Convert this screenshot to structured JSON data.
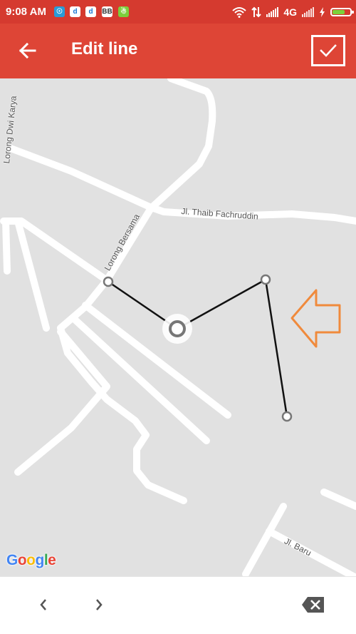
{
  "status_bar": {
    "time": "9:08 AM",
    "network": "4G",
    "notifications": [
      {
        "glyph": "☉",
        "bg": "#2a9bd7",
        "fg": "#ffffff"
      },
      {
        "glyph": "d",
        "bg": "#ffffff",
        "fg": "#1976d2"
      },
      {
        "glyph": "d",
        "bg": "#ffffff",
        "fg": "#1976d2"
      },
      {
        "glyph": "BB",
        "bg": "#ffffff",
        "fg": "#333333"
      },
      {
        "glyph": "☃",
        "bg": "#7ccf3b",
        "fg": "#ffffff"
      }
    ]
  },
  "toolbar": {
    "title": "Edit line",
    "back_icon": "arrow-left-icon",
    "confirm_icon": "check-icon"
  },
  "map": {
    "streets": {
      "dwi_karya": "Lorong Dwi Karya",
      "bersama": "Lorong Bersama",
      "thaib": "Jl. Thaib Fachruddin",
      "baru": "Jl. Baru"
    },
    "logo": {
      "G": "G",
      "o1": "o",
      "o2": "o",
      "g": "g",
      "l": "l",
      "e": "e"
    }
  },
  "bottom_bar": {
    "prev_icon": "chevron-left-icon",
    "next_icon": "chevron-right-icon",
    "delete_icon": "backspace-icon"
  },
  "colors": {
    "status_bar": "#d53a2f",
    "toolbar": "#de4536",
    "annotation_arrow": "#f08a3c",
    "line": "#111111",
    "vertex": "#777777"
  }
}
